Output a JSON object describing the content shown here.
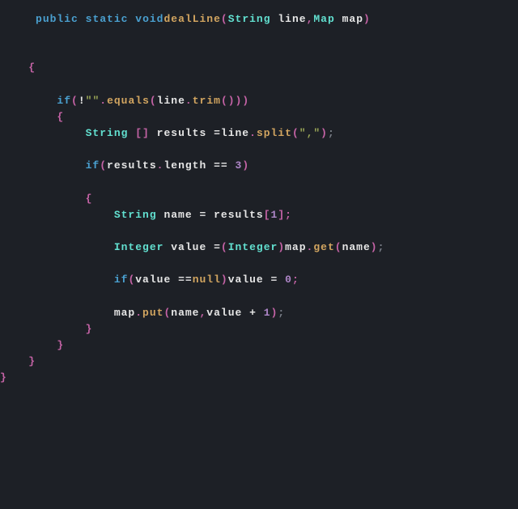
{
  "code": {
    "l01": {
      "indent": "     ",
      "kw_public": "public",
      "kw_static": "static",
      "kw_void": "void",
      "fn_dealLine": "dealLine",
      "p_open": "(",
      "t_string1": "String",
      "id_line": "line",
      "comma1": ",",
      "t_map": "Map",
      "id_map": "map",
      "p_close": ")"
    },
    "l03": {
      "indent": "    ",
      "brace": "{"
    },
    "l05": {
      "indent": "        ",
      "kw_if": "if",
      "p_open": "(",
      "op_not": "!",
      "str_empty": "\"\"",
      "dot1": ".",
      "fn_equals": "equals",
      "p2_open": "(",
      "id_line": "line",
      "dot2": ".",
      "fn_trim": "trim",
      "p3_open": "(",
      "p3_close": ")",
      "p2_close": ")",
      "p_close": ")"
    },
    "l06": {
      "indent": "        ",
      "brace": "{"
    },
    "l07": {
      "indent": "            ",
      "t_string": "String",
      "brackets": "[]",
      "id_results": "results",
      "op_eq": "=",
      "id_line": "line",
      "dot": ".",
      "fn_split": "split",
      "p_open": "(",
      "str_comma": "\",\"",
      "p_close": ")",
      "semi": ";"
    },
    "l09": {
      "indent": "            ",
      "kw_if": "if",
      "p_open": "(",
      "id_results": "results",
      "dot": ".",
      "id_length": "length",
      "op_eqeq": "==",
      "num_3": "3",
      "p_close": ")"
    },
    "l11": {
      "indent": "            ",
      "brace": "{"
    },
    "l12": {
      "indent": "                ",
      "t_string": "String",
      "id_name": "name",
      "op_eq": "=",
      "id_results": "results",
      "br_open": "[",
      "num_1": "1",
      "br_close": "]",
      "semi": ";"
    },
    "l14": {
      "indent": "                ",
      "t_integer": "Integer",
      "id_value": "value",
      "op_eq": "=",
      "p_open": "(",
      "t_integer2": "Integer",
      "p_close": ")",
      "id_map": "map",
      "dot": ".",
      "fn_get": "get",
      "p2_open": "(",
      "id_name": "name",
      "p2_close": ")",
      "semi": ";"
    },
    "l16": {
      "indent": "                ",
      "kw_if": "if",
      "p_open": "(",
      "id_value": "value",
      "op_eqeq": "==",
      "cnst_null": "null",
      "p_close": ")",
      "id_value2": "value",
      "op_eq": "=",
      "num_0": "0",
      "semi": ";"
    },
    "l18": {
      "indent": "                ",
      "id_map": "map",
      "dot": ".",
      "fn_put": "put",
      "p_open": "(",
      "id_name": "name",
      "comma": ",",
      "id_value": "value",
      "op_plus": "+",
      "num_1": "1",
      "p_close": ")",
      "semi": ";"
    },
    "l19": {
      "indent": "            ",
      "brace": "}"
    },
    "l20": {
      "indent": "        ",
      "brace": "}"
    },
    "l21": {
      "indent": "    ",
      "brace": "}"
    },
    "l22": {
      "indent": "",
      "brace": "}"
    }
  }
}
